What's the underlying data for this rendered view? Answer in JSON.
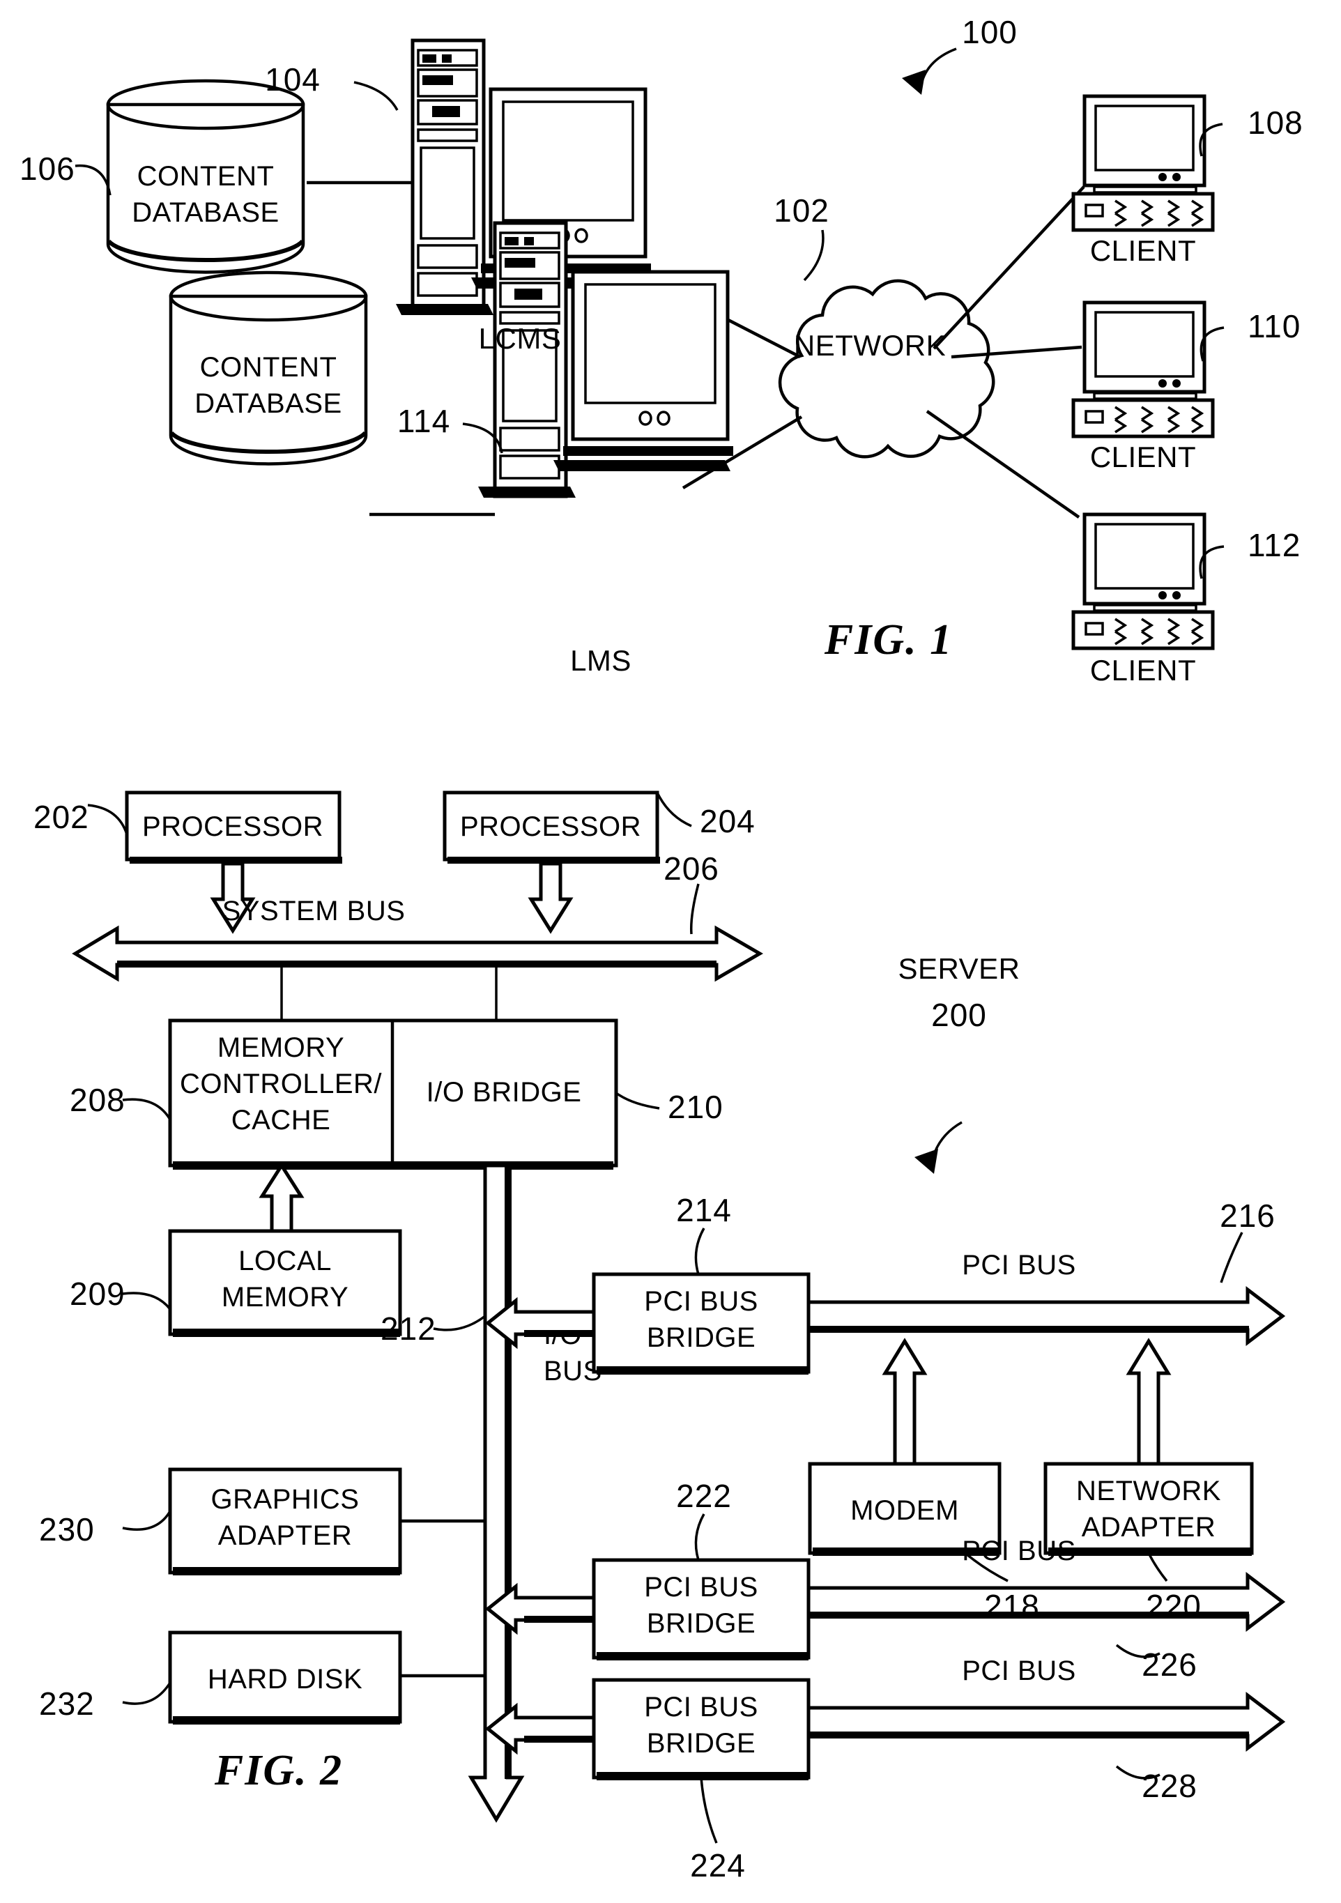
{
  "figure1": {
    "caption": "FIG. 1",
    "system_ref": "100",
    "network": {
      "label": "NETWORK",
      "ref": "102"
    },
    "servers": [
      {
        "name": "LCMS",
        "ref": "104",
        "database_label_line1": "CONTENT",
        "database_label_line2": "DATABASE",
        "database_ref": "106"
      },
      {
        "name": "LMS",
        "ref": "114",
        "database_label_line1": "CONTENT",
        "database_label_line2": "DATABASE",
        "database_ref": ""
      }
    ],
    "clients": [
      {
        "label": "CLIENT",
        "ref": "108"
      },
      {
        "label": "CLIENT",
        "ref": "110"
      },
      {
        "label": "CLIENT",
        "ref": "112"
      }
    ]
  },
  "figure2": {
    "caption": "FIG. 2",
    "system_label": "SERVER",
    "system_ref": "200",
    "blocks": [
      {
        "id": "processor1",
        "label": "PROCESSOR",
        "ref": "202"
      },
      {
        "id": "processor2",
        "label": "PROCESSOR",
        "ref": "204"
      },
      {
        "id": "memory_controller",
        "label_line1": "MEMORY",
        "label_line2": "CONTROLLER/",
        "label_line3": "CACHE",
        "ref": "208"
      },
      {
        "id": "io_bridge",
        "label": "I/O BRIDGE",
        "ref": "210"
      },
      {
        "id": "local_memory",
        "label_line1": "LOCAL",
        "label_line2": "MEMORY",
        "ref": "209"
      },
      {
        "id": "graphics_adapter",
        "label_line1": "GRAPHICS",
        "label_line2": "ADAPTER",
        "ref": "230"
      },
      {
        "id": "hard_disk",
        "label": "HARD DISK",
        "ref": "232"
      },
      {
        "id": "pci_bridge_1",
        "label_line1": "PCI BUS",
        "label_line2": "BRIDGE",
        "ref": "214"
      },
      {
        "id": "pci_bridge_2",
        "label_line1": "PCI BUS",
        "label_line2": "BRIDGE",
        "ref": "222"
      },
      {
        "id": "pci_bridge_3",
        "label_line1": "PCI BUS",
        "label_line2": "BRIDGE",
        "ref": "224"
      },
      {
        "id": "modem",
        "label": "MODEM",
        "ref": "218"
      },
      {
        "id": "network_adapter",
        "label_line1": "NETWORK",
        "label_line2": "ADAPTER",
        "ref": "220"
      }
    ],
    "buses": [
      {
        "id": "system_bus",
        "label": "SYSTEM BUS",
        "ref": "206"
      },
      {
        "id": "io_bus",
        "label_line1": "I/O",
        "label_line2": "BUS",
        "ref": "212"
      },
      {
        "id": "pci_bus_1",
        "label": "PCI BUS",
        "ref": "216"
      },
      {
        "id": "pci_bus_2",
        "label": "PCI BUS",
        "ref": "226"
      },
      {
        "id": "pci_bus_3",
        "label": "PCI BUS",
        "ref": "228"
      }
    ]
  }
}
